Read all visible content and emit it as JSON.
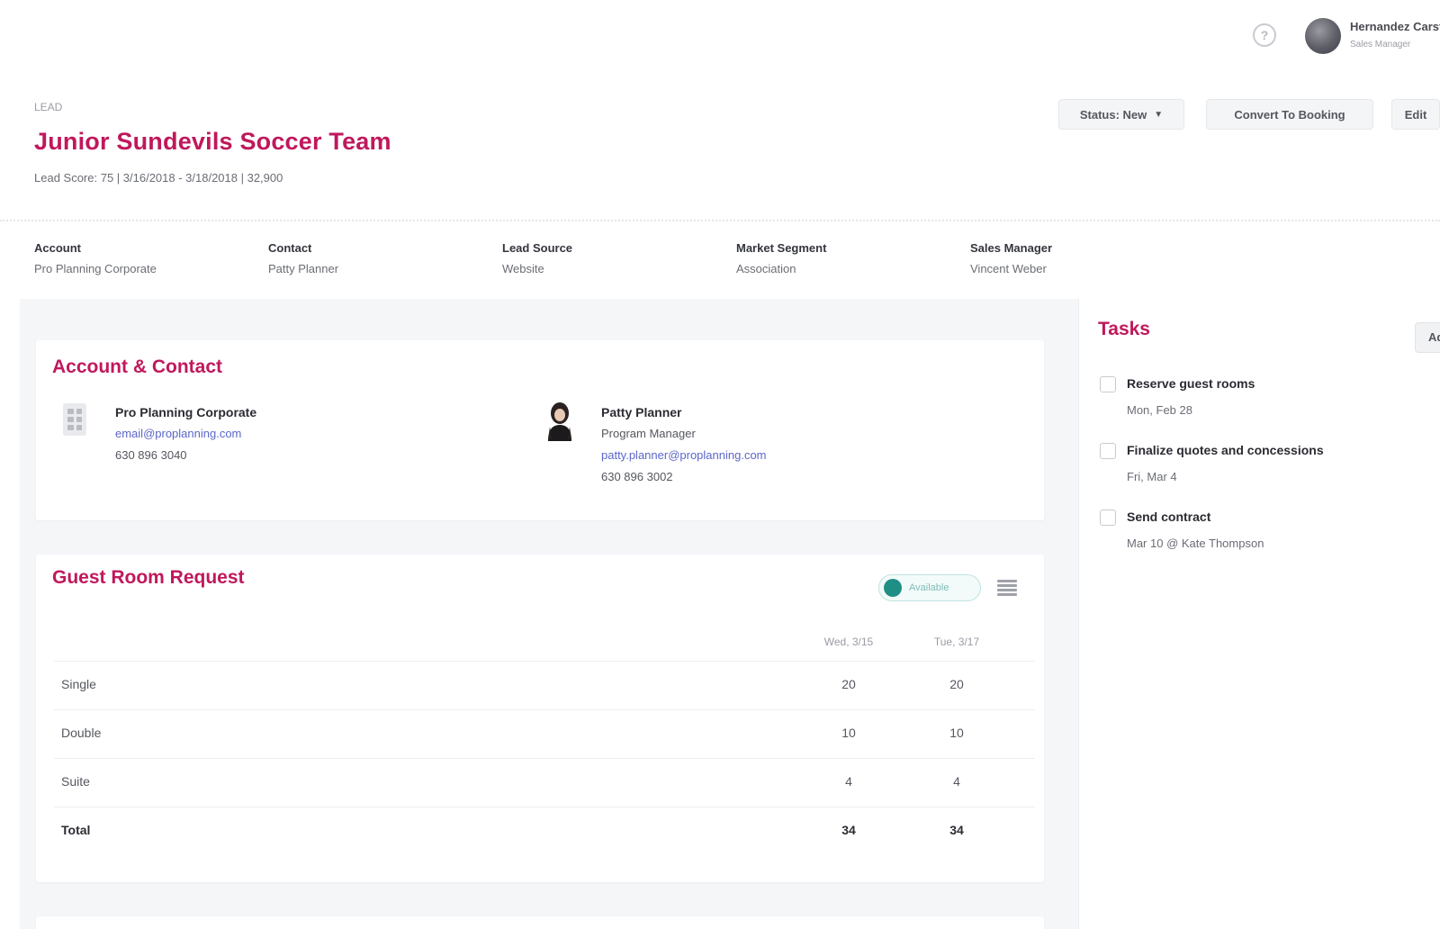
{
  "topbar": {
    "help_icon": "help-circle-icon",
    "user_name": "Hernandez Carsten",
    "user_role": "Sales Manager"
  },
  "header": {
    "record_type": "LEAD",
    "title": "Junior Sundevils Soccer Team",
    "subtitle": "Lead Score: 75 | 3/16/2018 - 3/18/2018 | 32,900",
    "status_button": "Status: New",
    "convert_button": "Convert To Booking",
    "edit_button": "Edit"
  },
  "facts": [
    {
      "label": "Account",
      "value": "Pro Planning Corporate"
    },
    {
      "label": "Contact",
      "value": "Patty Planner"
    },
    {
      "label": "Lead Source",
      "value": "Website"
    },
    {
      "label": "Market Segment",
      "value": "Association"
    },
    {
      "label": "Sales Manager",
      "value": "Vincent Weber"
    }
  ],
  "account_contact": {
    "title": "Account & Contact",
    "account": {
      "name": "Pro Planning Corporate",
      "email": "email@proplanning.com",
      "phone": "630 896 3040"
    },
    "contact": {
      "name": "Patty Planner",
      "role": "Program Manager",
      "email": "patty.planner@proplanning.com",
      "phone": "630 896 3002"
    }
  },
  "guest_rooms": {
    "title": "Guest Room Request",
    "toggle_label": "Available",
    "columns": [
      "Wed, 3/15",
      "Tue, 3/17"
    ],
    "rows": [
      {
        "label": "Single",
        "values": [
          "20",
          "20"
        ]
      },
      {
        "label": "Double",
        "values": [
          "10",
          "10"
        ]
      },
      {
        "label": "Suite",
        "values": [
          "4",
          "4"
        ]
      }
    ],
    "total": {
      "label": "Total",
      "values": [
        "34",
        "34"
      ]
    }
  },
  "tasks": {
    "title": "Tasks",
    "add_button": "Ad",
    "items": [
      {
        "title": "Reserve guest rooms",
        "meta": "Mon, Feb 28"
      },
      {
        "title": "Finalize quotes and concessions",
        "meta": "Fri, Mar 4"
      },
      {
        "title": "Send contract",
        "meta": "Mar 10 @ Kate Thompson"
      }
    ]
  }
}
